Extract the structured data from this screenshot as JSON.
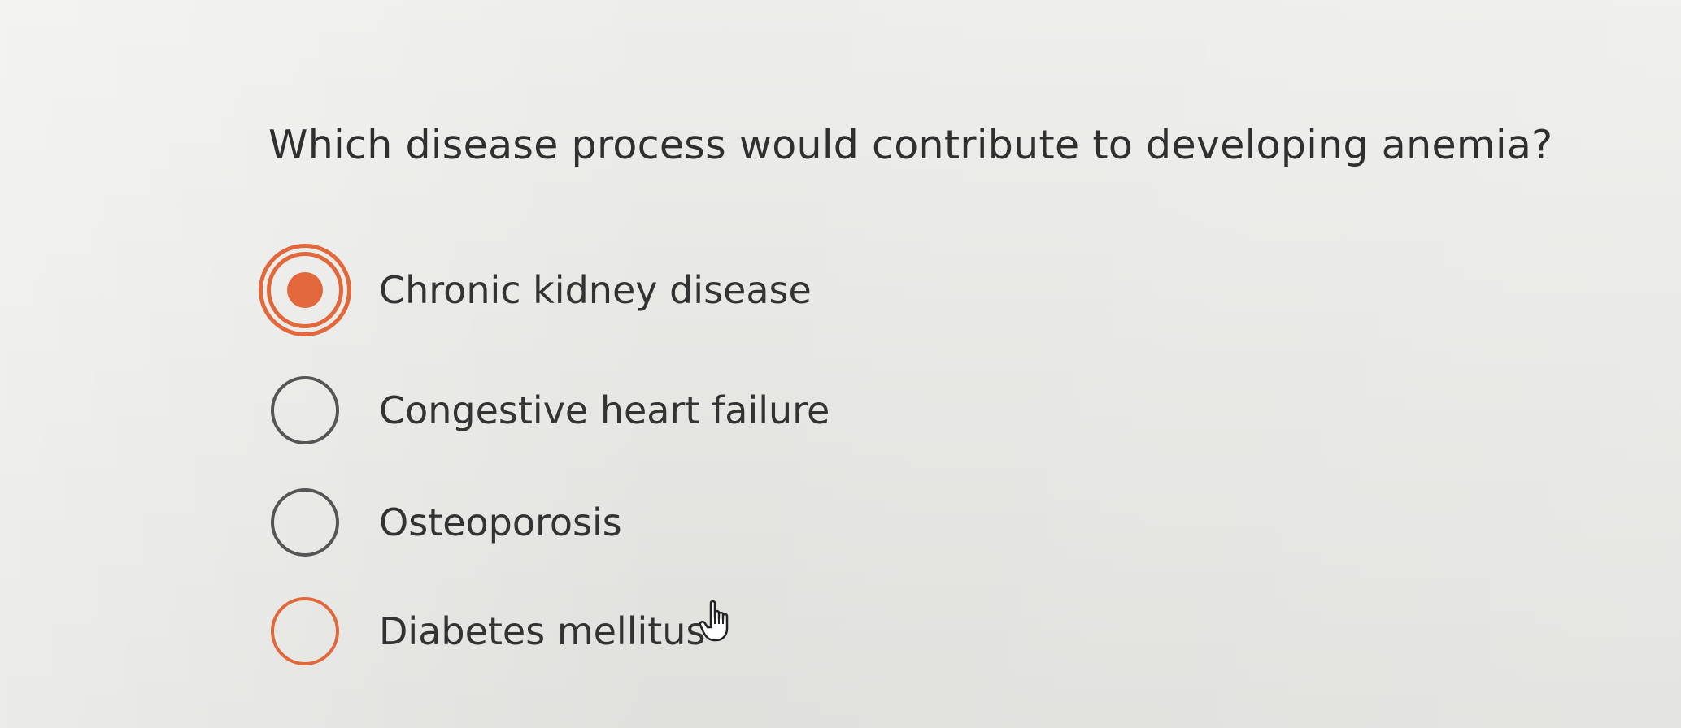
{
  "question": {
    "text": "Which disease process would contribute to developing anemia?"
  },
  "options": [
    {
      "label": "Chronic kidney disease",
      "state": "selected"
    },
    {
      "label": "Congestive heart failure",
      "state": "unselected"
    },
    {
      "label": "Osteoporosis",
      "state": "unselected"
    },
    {
      "label": "Diabetes mellitus",
      "state": "hover"
    }
  ],
  "colors": {
    "accent": "#e2683c",
    "radio_border": "#555555",
    "text": "#2f2f2f",
    "background": "#e7e7e4"
  },
  "icons": {
    "cursor": "hand-pointer-icon"
  }
}
